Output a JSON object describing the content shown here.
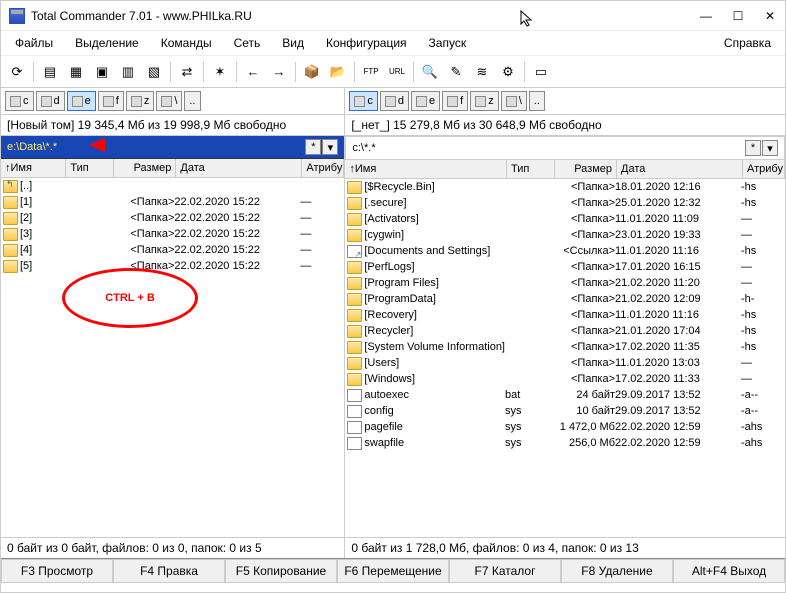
{
  "window": {
    "title": "Total Commander 7.01 - www.PHILka.RU"
  },
  "menu": {
    "items": [
      "Файлы",
      "Выделение",
      "Команды",
      "Сеть",
      "Вид",
      "Конфигурация",
      "Запуск"
    ],
    "right": "Справка"
  },
  "drives": {
    "left_active": "e",
    "right_active": "c",
    "items": [
      "c",
      "d",
      "e",
      "f",
      "z",
      "\\"
    ],
    "dots": ".."
  },
  "left": {
    "free": "[Новый том]  19 345,4 Мб из 19 998,9 Мб свободно",
    "path": "e:\\Data\\*.*",
    "status": "0 байт из 0 байт, файлов: 0 из 0, папок: 0 из 5",
    "rows": [
      {
        "icon": "up",
        "name": "[..]",
        "type": "",
        "size": "",
        "date": "",
        "attr": ""
      },
      {
        "icon": "folder",
        "name": "[1]",
        "type": "",
        "size": "<Папка>",
        "date": "22.02.2020 15:22",
        "attr": "—"
      },
      {
        "icon": "folder",
        "name": "[2]",
        "type": "",
        "size": "<Папка>",
        "date": "22.02.2020 15:22",
        "attr": "—"
      },
      {
        "icon": "folder",
        "name": "[3]",
        "type": "",
        "size": "<Папка>",
        "date": "22.02.2020 15:22",
        "attr": "—"
      },
      {
        "icon": "folder",
        "name": "[4]",
        "type": "",
        "size": "<Папка>",
        "date": "22.02.2020 15:22",
        "attr": "—"
      },
      {
        "icon": "folder",
        "name": "[5]",
        "type": "",
        "size": "<Папка>",
        "date": "22.02.2020 15:22",
        "attr": "—"
      }
    ]
  },
  "right": {
    "free": "[_нет_]  15 279,8 Мб из 30 648,9 Мб свободно",
    "path": "c:\\*.*",
    "status": "0 байт из 1 728,0 Мб, файлов: 0 из 4, папок: 0 из 13",
    "rows": [
      {
        "icon": "folder",
        "name": "[$Recycle.Bin]",
        "type": "",
        "size": "<Папка>",
        "date": "18.01.2020 12:16",
        "attr": "-hs"
      },
      {
        "icon": "folder",
        "name": "[.secure]",
        "type": "",
        "size": "<Папка>",
        "date": "25.01.2020 12:32",
        "attr": "-hs"
      },
      {
        "icon": "folder",
        "name": "[Activators]",
        "type": "",
        "size": "<Папка>",
        "date": "11.01.2020 11:09",
        "attr": "—"
      },
      {
        "icon": "folder",
        "name": "[cygwin]",
        "type": "",
        "size": "<Папка>",
        "date": "23.01.2020 19:33",
        "attr": "—"
      },
      {
        "icon": "link",
        "name": "[Documents and Settings]",
        "type": "",
        "size": "<Ссылка>",
        "date": "11.01.2020 11:16",
        "attr": "-hs"
      },
      {
        "icon": "folder",
        "name": "[PerfLogs]",
        "type": "",
        "size": "<Папка>",
        "date": "17.01.2020 16:15",
        "attr": "—"
      },
      {
        "icon": "folder",
        "name": "[Program Files]",
        "type": "",
        "size": "<Папка>",
        "date": "21.02.2020 11:20",
        "attr": "—"
      },
      {
        "icon": "folder",
        "name": "[ProgramData]",
        "type": "",
        "size": "<Папка>",
        "date": "21.02.2020 12:09",
        "attr": "-h-"
      },
      {
        "icon": "folder",
        "name": "[Recovery]",
        "type": "",
        "size": "<Папка>",
        "date": "11.01.2020 11:16",
        "attr": "-hs"
      },
      {
        "icon": "folder",
        "name": "[Recycler]",
        "type": "",
        "size": "<Папка>",
        "date": "21.01.2020 17:04",
        "attr": "-hs"
      },
      {
        "icon": "folder",
        "name": "[System Volume Information]",
        "type": "",
        "size": "<Папка>",
        "date": "17.02.2020 11:35",
        "attr": "-hs"
      },
      {
        "icon": "folder",
        "name": "[Users]",
        "type": "",
        "size": "<Папка>",
        "date": "11.01.2020 13:03",
        "attr": "—"
      },
      {
        "icon": "folder",
        "name": "[Windows]",
        "type": "",
        "size": "<Папка>",
        "date": "17.02.2020 11:33",
        "attr": "—"
      },
      {
        "icon": "file",
        "name": "autoexec",
        "type": "bat",
        "size": "24 байт",
        "date": "29.09.2017 13:52",
        "attr": "-a--"
      },
      {
        "icon": "file",
        "name": "config",
        "type": "sys",
        "size": "10 байт",
        "date": "29.09.2017 13:52",
        "attr": "-a--"
      },
      {
        "icon": "file",
        "name": "pagefile",
        "type": "sys",
        "size": "1 472,0 Мб",
        "date": "22.02.2020 12:59",
        "attr": "-ahs"
      },
      {
        "icon": "file",
        "name": "swapfile",
        "type": "sys",
        "size": "256,0 Мб",
        "date": "22.02.2020 12:59",
        "attr": "-ahs"
      }
    ]
  },
  "cols": {
    "name": "↑Имя",
    "type": "Тип",
    "size": "Размер",
    "date": "Дата",
    "attr": "Атрибу"
  },
  "fkeys": [
    "F3 Просмотр",
    "F4 Правка",
    "F5 Копирование",
    "F6 Перемещение",
    "F7 Каталог",
    "F8 Удаление",
    "Alt+F4 Выход"
  ],
  "annot": {
    "text": "CTRL + B"
  },
  "toolbar_icons": [
    "refresh",
    "tree1",
    "tree2",
    "view",
    "cmd",
    "notepad",
    "",
    "sync",
    "",
    "star",
    "",
    "back",
    "fwd",
    "",
    "pack",
    "unpack",
    "",
    "ftp",
    "url",
    "",
    "find",
    "rename",
    "diff",
    "props",
    "",
    "ext"
  ]
}
